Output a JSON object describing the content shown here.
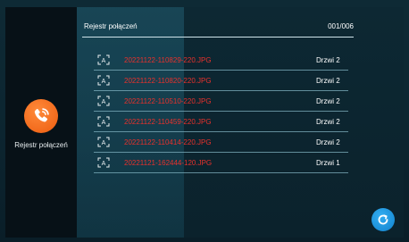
{
  "sidebar": {
    "icon": "phone-call-log-icon",
    "label": "Rejestr połączeń",
    "accent": "#f26a1c"
  },
  "header": {
    "title": "Rejestr połączeń",
    "count": "001/006"
  },
  "records": [
    {
      "icon": "photo-record-icon",
      "file": "20221122-110829-220.JPG",
      "door": "Drzwi 2"
    },
    {
      "icon": "photo-record-icon",
      "file": "20221122-110820-220.JPG",
      "door": "Drzwi 2"
    },
    {
      "icon": "photo-record-icon",
      "file": "20221122-110510-220.JPG",
      "door": "Drzwi 2"
    },
    {
      "icon": "photo-record-icon",
      "file": "20221122-110459-220.JPG",
      "door": "Drzwi 2"
    },
    {
      "icon": "photo-record-icon",
      "file": "20221122-110414-220.JPG",
      "door": "Drzwi 2"
    },
    {
      "icon": "photo-record-icon",
      "file": "20221121-162444-120.JPG",
      "door": "Drzwi 1"
    }
  ],
  "colors": {
    "file_text": "#e8312c",
    "refresh_button": "#1b8fd8"
  },
  "refresh": {
    "icon": "refresh-icon"
  }
}
